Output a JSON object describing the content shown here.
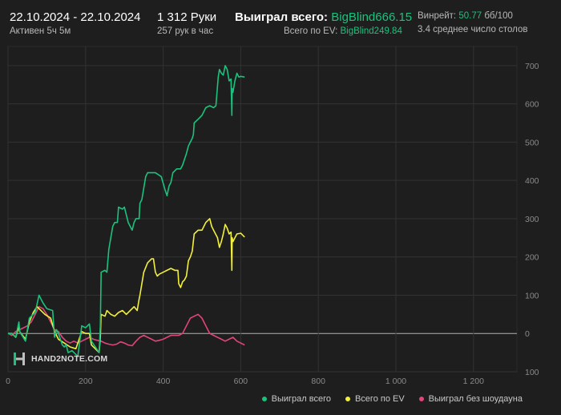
{
  "header": {
    "date_range": "22.10.2024 - 22.10.2024",
    "active_time": "Активен 5ч 5м",
    "hands": "1 312 Руки",
    "hands_per_hour": "257 рук в час",
    "won_total_label": "Выиграл всего:",
    "won_total_value": "BigBlind666.15",
    "ev_total_label": "Всего по EV:",
    "ev_total_value": "BigBlind249.84",
    "winrate_label": "Винрейт:",
    "winrate_value": "50.77",
    "winrate_unit": "бб/100",
    "avg_tables": "3.4 среднее число столов"
  },
  "logo": {
    "text": "HAND2NOTE.COM"
  },
  "colors": {
    "background": "#1e1e1e",
    "won": "#19c37d",
    "ev": "#f2f03a",
    "nosd": "#e0457b",
    "grid": "#333333",
    "zero_line": "#b0b0b0",
    "tick": "#8a8a8a"
  },
  "chart_data": {
    "type": "line",
    "xlim": [
      0,
      1312
    ],
    "ylim": [
      -100,
      750
    ],
    "x_ticks": [
      "0",
      "200",
      "400",
      "600",
      "800",
      "1 000",
      "1 200"
    ],
    "x_tick_values": [
      0,
      200,
      400,
      600,
      800,
      1000,
      1200
    ],
    "y_ticks": [
      "700",
      "600",
      "500",
      "400",
      "300",
      "200",
      "100",
      "0",
      "100"
    ],
    "y_tick_values": [
      700,
      600,
      500,
      400,
      300,
      200,
      100,
      0,
      -100
    ],
    "grid": true,
    "legend_position": "bottom-right",
    "series": [
      {
        "name": "Выиграл всего",
        "color": "#19c37d",
        "points": [
          [
            0,
            0
          ],
          [
            10,
            0
          ],
          [
            20,
            -10
          ],
          [
            28,
            30
          ],
          [
            30,
            5
          ],
          [
            45,
            -20
          ],
          [
            55,
            40
          ],
          [
            70,
            55
          ],
          [
            80,
            100
          ],
          [
            90,
            80
          ],
          [
            100,
            65
          ],
          [
            115,
            60
          ],
          [
            120,
            -10
          ],
          [
            125,
            10
          ],
          [
            130,
            0
          ],
          [
            140,
            -30
          ],
          [
            145,
            -35
          ],
          [
            150,
            -30
          ],
          [
            155,
            -50
          ],
          [
            165,
            -45
          ],
          [
            180,
            -60
          ],
          [
            190,
            20
          ],
          [
            200,
            15
          ],
          [
            210,
            25
          ],
          [
            215,
            -20
          ],
          [
            235,
            -50
          ],
          [
            238,
            20
          ],
          [
            240,
            160
          ],
          [
            250,
            165
          ],
          [
            255,
            160
          ],
          [
            260,
            220
          ],
          [
            270,
            280
          ],
          [
            275,
            290
          ],
          [
            282,
            290
          ],
          [
            285,
            330
          ],
          [
            295,
            325
          ],
          [
            300,
            330
          ],
          [
            310,
            290
          ],
          [
            320,
            270
          ],
          [
            325,
            290
          ],
          [
            330,
            300
          ],
          [
            338,
            300
          ],
          [
            340,
            340
          ],
          [
            345,
            350
          ],
          [
            355,
            410
          ],
          [
            360,
            420
          ],
          [
            370,
            420
          ],
          [
            380,
            420
          ],
          [
            395,
            410
          ],
          [
            405,
            375
          ],
          [
            410,
            360
          ],
          [
            415,
            385
          ],
          [
            420,
            395
          ],
          [
            425,
            420
          ],
          [
            430,
            425
          ],
          [
            435,
            430
          ],
          [
            445,
            430
          ],
          [
            450,
            440
          ],
          [
            455,
            455
          ],
          [
            460,
            470
          ],
          [
            465,
            490
          ],
          [
            470,
            500
          ],
          [
            475,
            510
          ],
          [
            478,
            520
          ],
          [
            480,
            550
          ],
          [
            490,
            560
          ],
          [
            500,
            570
          ],
          [
            510,
            590
          ],
          [
            520,
            595
          ],
          [
            530,
            590
          ],
          [
            536,
            595
          ],
          [
            538,
            620
          ],
          [
            542,
            670
          ],
          [
            545,
            690
          ],
          [
            550,
            680
          ],
          [
            555,
            675
          ],
          [
            560,
            700
          ],
          [
            565,
            690
          ],
          [
            570,
            660
          ],
          [
            575,
            665
          ],
          [
            577,
            570
          ],
          [
            578,
            640
          ],
          [
            580,
            630
          ],
          [
            585,
            660
          ],
          [
            590,
            680
          ],
          [
            595,
            670
          ],
          [
            600,
            672
          ],
          [
            610,
            670
          ]
        ]
      },
      {
        "name": "Всего по EV",
        "color": "#f2f03a",
        "points": [
          [
            0,
            0
          ],
          [
            10,
            0
          ],
          [
            20,
            -10
          ],
          [
            28,
            20
          ],
          [
            30,
            5
          ],
          [
            45,
            -15
          ],
          [
            55,
            30
          ],
          [
            65,
            55
          ],
          [
            75,
            70
          ],
          [
            85,
            60
          ],
          [
            95,
            50
          ],
          [
            110,
            40
          ],
          [
            120,
            5
          ],
          [
            125,
            -5
          ],
          [
            130,
            -15
          ],
          [
            145,
            -25
          ],
          [
            160,
            -35
          ],
          [
            175,
            -40
          ],
          [
            190,
            5
          ],
          [
            200,
            0
          ],
          [
            210,
            0
          ],
          [
            215,
            -30
          ],
          [
            235,
            -50
          ],
          [
            238,
            -10
          ],
          [
            240,
            50
          ],
          [
            250,
            45
          ],
          [
            255,
            60
          ],
          [
            265,
            50
          ],
          [
            275,
            45
          ],
          [
            285,
            55
          ],
          [
            295,
            60
          ],
          [
            305,
            50
          ],
          [
            315,
            60
          ],
          [
            325,
            70
          ],
          [
            333,
            60
          ],
          [
            338,
            90
          ],
          [
            340,
            100
          ],
          [
            345,
            130
          ],
          [
            350,
            160
          ],
          [
            360,
            185
          ],
          [
            370,
            195
          ],
          [
            375,
            195
          ],
          [
            380,
            160
          ],
          [
            385,
            150
          ],
          [
            390,
            155
          ],
          [
            400,
            160
          ],
          [
            410,
            165
          ],
          [
            420,
            170
          ],
          [
            430,
            165
          ],
          [
            438,
            165
          ],
          [
            440,
            130
          ],
          [
            445,
            120
          ],
          [
            450,
            135
          ],
          [
            455,
            140
          ],
          [
            460,
            150
          ],
          [
            465,
            190
          ],
          [
            470,
            200
          ],
          [
            475,
            215
          ],
          [
            480,
            260
          ],
          [
            490,
            270
          ],
          [
            500,
            270
          ],
          [
            505,
            280
          ],
          [
            510,
            290
          ],
          [
            520,
            300
          ],
          [
            525,
            280
          ],
          [
            530,
            270
          ],
          [
            535,
            260
          ],
          [
            540,
            250
          ],
          [
            545,
            225
          ],
          [
            550,
            240
          ],
          [
            555,
            260
          ],
          [
            560,
            285
          ],
          [
            565,
            275
          ],
          [
            570,
            260
          ],
          [
            575,
            265
          ],
          [
            577,
            165
          ],
          [
            578,
            250
          ],
          [
            580,
            240
          ],
          [
            585,
            250
          ],
          [
            590,
            260
          ],
          [
            600,
            262
          ],
          [
            610,
            252
          ]
        ]
      },
      {
        "name": "Выиграл без шоудауна",
        "color": "#e0457b",
        "points": [
          [
            0,
            0
          ],
          [
            10,
            -5
          ],
          [
            20,
            5
          ],
          [
            30,
            10
          ],
          [
            40,
            15
          ],
          [
            50,
            20
          ],
          [
            60,
            30
          ],
          [
            70,
            50
          ],
          [
            80,
            70
          ],
          [
            90,
            65
          ],
          [
            100,
            50
          ],
          [
            110,
            30
          ],
          [
            120,
            10
          ],
          [
            130,
            5
          ],
          [
            140,
            -10
          ],
          [
            150,
            -20
          ],
          [
            160,
            -25
          ],
          [
            170,
            -20
          ],
          [
            180,
            -25
          ],
          [
            190,
            -20
          ],
          [
            200,
            -15
          ],
          [
            210,
            -10
          ],
          [
            220,
            -15
          ],
          [
            230,
            -18
          ],
          [
            240,
            -20
          ],
          [
            250,
            -25
          ],
          [
            260,
            -28
          ],
          [
            270,
            -30
          ],
          [
            280,
            -28
          ],
          [
            290,
            -22
          ],
          [
            300,
            -25
          ],
          [
            310,
            -30
          ],
          [
            320,
            -32
          ],
          [
            330,
            -20
          ],
          [
            340,
            -10
          ],
          [
            350,
            -5
          ],
          [
            360,
            -10
          ],
          [
            370,
            -15
          ],
          [
            380,
            -20
          ],
          [
            390,
            -18
          ],
          [
            400,
            -15
          ],
          [
            410,
            -10
          ],
          [
            420,
            -5
          ],
          [
            430,
            -5
          ],
          [
            440,
            -5
          ],
          [
            450,
            0
          ],
          [
            460,
            20
          ],
          [
            470,
            40
          ],
          [
            480,
            45
          ],
          [
            490,
            50
          ],
          [
            500,
            40
          ],
          [
            510,
            20
          ],
          [
            520,
            0
          ],
          [
            530,
            -5
          ],
          [
            540,
            -10
          ],
          [
            550,
            -15
          ],
          [
            560,
            -20
          ],
          [
            570,
            -15
          ],
          [
            580,
            -10
          ],
          [
            590,
            -20
          ],
          [
            600,
            -25
          ],
          [
            610,
            -30
          ]
        ]
      }
    ]
  }
}
